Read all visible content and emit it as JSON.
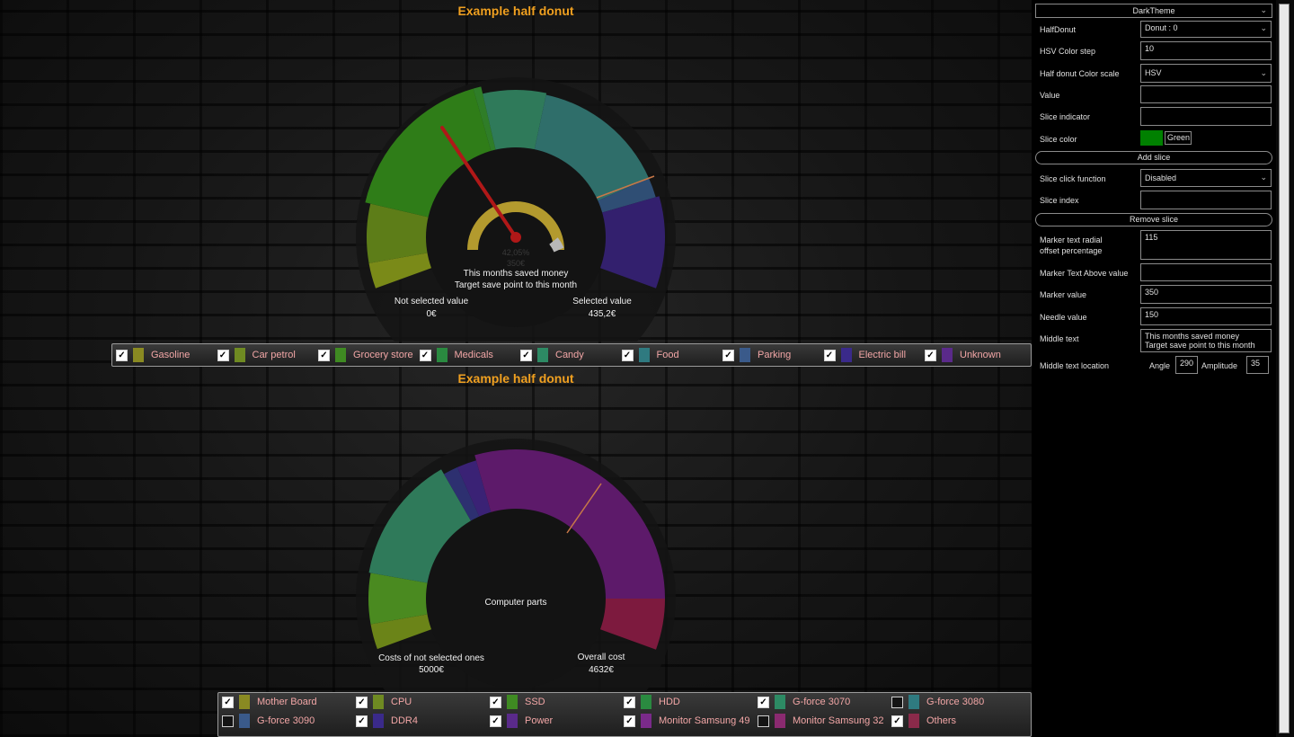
{
  "chart1": {
    "title": "Example half donut",
    "middle_text_line1": "This months saved money",
    "middle_text_line2": "Target save point to this month",
    "gauge_percent": "42,05%",
    "gauge_sub": "350€",
    "left_label": "Not selected value",
    "left_value": "0€",
    "right_label": "Selected value",
    "right_value": "435,2€",
    "legend": [
      {
        "label": "Gasoline",
        "color": "#8a8a22",
        "checked": true
      },
      {
        "label": "Car petrol",
        "color": "#6f8a22",
        "checked": true
      },
      {
        "label": "Grocery store",
        "color": "#3f8a22",
        "checked": true
      },
      {
        "label": "Medicals",
        "color": "#2a8a40",
        "checked": true
      },
      {
        "label": "Candy",
        "color": "#2d8a64",
        "checked": true
      },
      {
        "label": "Food",
        "color": "#2f7a80",
        "checked": true
      },
      {
        "label": "Parking",
        "color": "#3a5a8a",
        "checked": true
      },
      {
        "label": "Electric bill",
        "color": "#3a2a8a",
        "checked": true
      },
      {
        "label": "Unknown",
        "color": "#5a2a8a",
        "checked": true
      }
    ]
  },
  "chart2": {
    "title": "Example half donut",
    "middle_text": "Computer parts",
    "left_label": "Costs of not selected ones",
    "left_value": "5000€",
    "right_label": "Overall cost",
    "right_value": "4632€",
    "legend": [
      {
        "label": "Mother Board",
        "color": "#8a8a22",
        "checked": true
      },
      {
        "label": "CPU",
        "color": "#6f8a22",
        "checked": true
      },
      {
        "label": "SSD",
        "color": "#3f8a22",
        "checked": true
      },
      {
        "label": "HDD",
        "color": "#2a8a40",
        "checked": true
      },
      {
        "label": "G-force 3070",
        "color": "#2d8a64",
        "checked": true
      },
      {
        "label": "G-force 3080",
        "color": "#2f7a80",
        "checked": false
      },
      {
        "label": "G-force 3090",
        "color": "#3a5a8a",
        "checked": false
      },
      {
        "label": "DDR4",
        "color": "#3a2a8a",
        "checked": true
      },
      {
        "label": "Power",
        "color": "#5a2a8a",
        "checked": true
      },
      {
        "label": "Monitor Samsung 49",
        "color": "#7a2a8a",
        "checked": true
      },
      {
        "label": "Monitor Samsung 32",
        "color": "#8a2a70",
        "checked": false
      },
      {
        "label": "Others",
        "color": "#8a2a4a",
        "checked": true
      }
    ]
  },
  "panel": {
    "theme": "DarkTheme",
    "halfdonut_label": "HalfDonut",
    "halfdonut_value": "Donut : 0",
    "hsv_step_label": "HSV Color step",
    "hsv_step_value": "10",
    "color_scale_label": "Half donut Color scale",
    "color_scale_value": "HSV",
    "value_label": "Value",
    "value_value": "",
    "slice_indicator_label": "Slice indicator",
    "slice_indicator_value": "",
    "slice_color_label": "Slice color",
    "slice_color_name": "Green",
    "slice_color_hex": "#008000",
    "add_slice": "Add slice",
    "click_fn_label": "Slice click function",
    "click_fn_value": "Disabled",
    "slice_index_label": "Slice index",
    "slice_index_value": "",
    "remove_slice": "Remove slice",
    "radial_label_1": "Marker text radial",
    "radial_label_2": "offset percentage",
    "radial_value": "115",
    "above_label": "Marker Text Above value",
    "above_value": "",
    "marker_value_label": "Marker value",
    "marker_value": "350",
    "needle_label": "Needle value",
    "needle_value": "150",
    "middle_text_label": "Middle text",
    "middle_text_1": "This months saved money",
    "middle_text_2": "Target save point to this month",
    "location_label": "Middle text location",
    "angle_label": "Angle",
    "angle_value": "290",
    "amplitude_label": "Amplitude",
    "amplitude_value": "35"
  }
}
